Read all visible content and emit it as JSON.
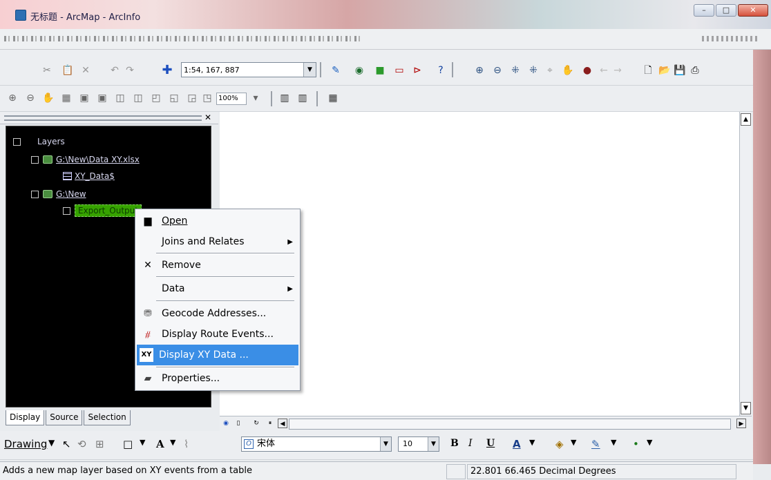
{
  "window": {
    "title": "无标题 - ArcMap - ArcInfo",
    "win_min": "–",
    "win_max": "□",
    "win_close": "✕"
  },
  "toolbar": {
    "scale_value": "1:54, 167, 887",
    "zoom_percent": "100%"
  },
  "toc": {
    "root_label": "Layers",
    "groups": [
      {
        "label": "G:\\New\\Data XY.xlsx",
        "child": "XY_Data$"
      },
      {
        "label": "G:\\New",
        "child": "Export_Output"
      }
    ],
    "close_glyph": "✕"
  },
  "tabs": [
    "Display",
    "Source",
    "Selection"
  ],
  "context_menu": {
    "items": [
      {
        "label": "Open",
        "icon": "table-open-icon"
      },
      {
        "label": "Joins and Relates",
        "icon": "",
        "submenu": true
      },
      {
        "label": "Remove",
        "icon": "remove-x-icon"
      },
      {
        "label": "Data",
        "icon": "",
        "submenu": true
      },
      {
        "label": "Geocode Addresses...",
        "icon": "geocode-icon"
      },
      {
        "label": "Display Route Events...",
        "icon": "route-events-icon"
      },
      {
        "label": "Display XY Data ...",
        "icon": "xy-data-icon",
        "selected": true
      },
      {
        "label": "Properties...",
        "icon": "properties-icon"
      }
    ]
  },
  "drawing_toolbar": {
    "drawing_label": "Drawing",
    "font_name": "宋体",
    "font_size": "10",
    "bold": "B",
    "italic": "I",
    "underline": "U"
  },
  "statusbar": {
    "message": "Adds a new map layer based on XY events from a table",
    "coordinates": "22.801  66.465 Decimal Degrees"
  },
  "colors": {
    "selection": "#3a8ee6",
    "toc_bg": "#000000",
    "highlight": "#36a200"
  }
}
